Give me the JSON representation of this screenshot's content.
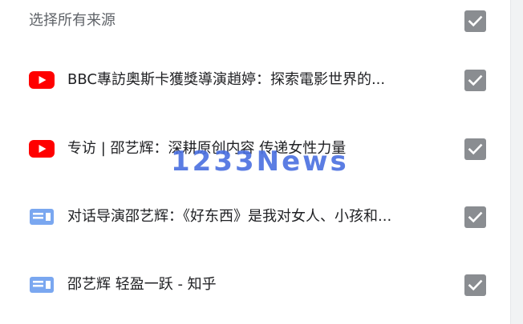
{
  "header": {
    "select_all_label": "选择所有来源",
    "select_all_checked": true
  },
  "sources": [
    {
      "icon": "youtube-icon",
      "title": "BBC專訪奧斯卡獲獎導演趙婷：探索電影世界的...",
      "checked": true
    },
    {
      "icon": "youtube-icon",
      "title": "专访 | 邵艺辉：深耕原创内容 传递女性力量",
      "checked": true
    },
    {
      "icon": "article-icon",
      "title": "对话导演邵艺辉：《好东西》是我对女人、小孩和...",
      "checked": true
    },
    {
      "icon": "article-icon",
      "title": "邵艺辉 轻盈一跃 - 知乎",
      "checked": true
    }
  ],
  "watermark": {
    "text": "1233News"
  },
  "colors": {
    "youtube_red": "#ff0000",
    "article_blue": "#7aa7f0",
    "checkbox_gray": "#8a8d91"
  }
}
